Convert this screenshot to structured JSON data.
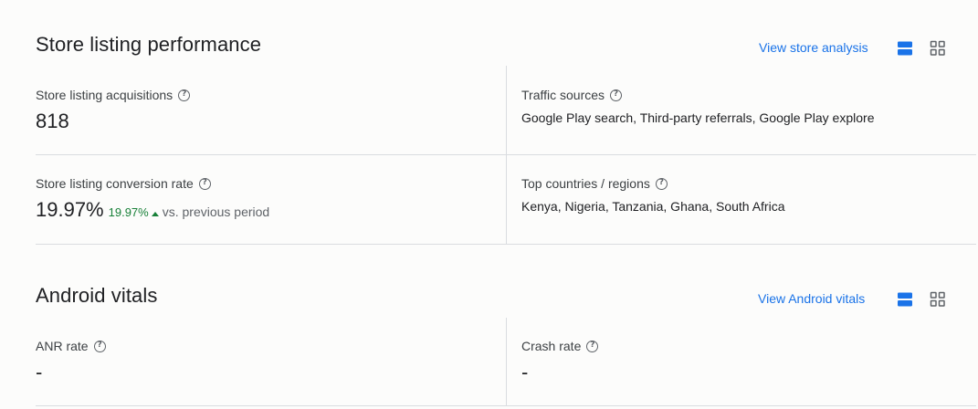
{
  "store_listing": {
    "title": "Store listing performance",
    "view_link": "View store analysis",
    "acquisitions": {
      "label": "Store listing acquisitions",
      "value": "818"
    },
    "traffic_sources": {
      "label": "Traffic sources",
      "value": "Google Play search, Third-party referrals, Google Play explore"
    },
    "conversion_rate": {
      "label": "Store listing conversion rate",
      "value": "19.97%",
      "delta": "19.97%",
      "compare": "vs. previous period"
    },
    "top_countries": {
      "label": "Top countries / regions",
      "value": "Kenya, Nigeria, Tanzania, Ghana, South Africa"
    }
  },
  "android_vitals": {
    "title": "Android vitals",
    "view_link": "View Android vitals",
    "anr_rate": {
      "label": "ANR rate",
      "value": "-"
    },
    "crash_rate": {
      "label": "Crash rate",
      "value": "-"
    }
  },
  "help_glyph": "?",
  "icons": {
    "list_view": "list-view-icon",
    "grid_view": "grid-view-icon",
    "help": "help-icon"
  },
  "colors": {
    "accent": "#1a73e8",
    "positive": "#188038",
    "divider": "#dadce0"
  }
}
